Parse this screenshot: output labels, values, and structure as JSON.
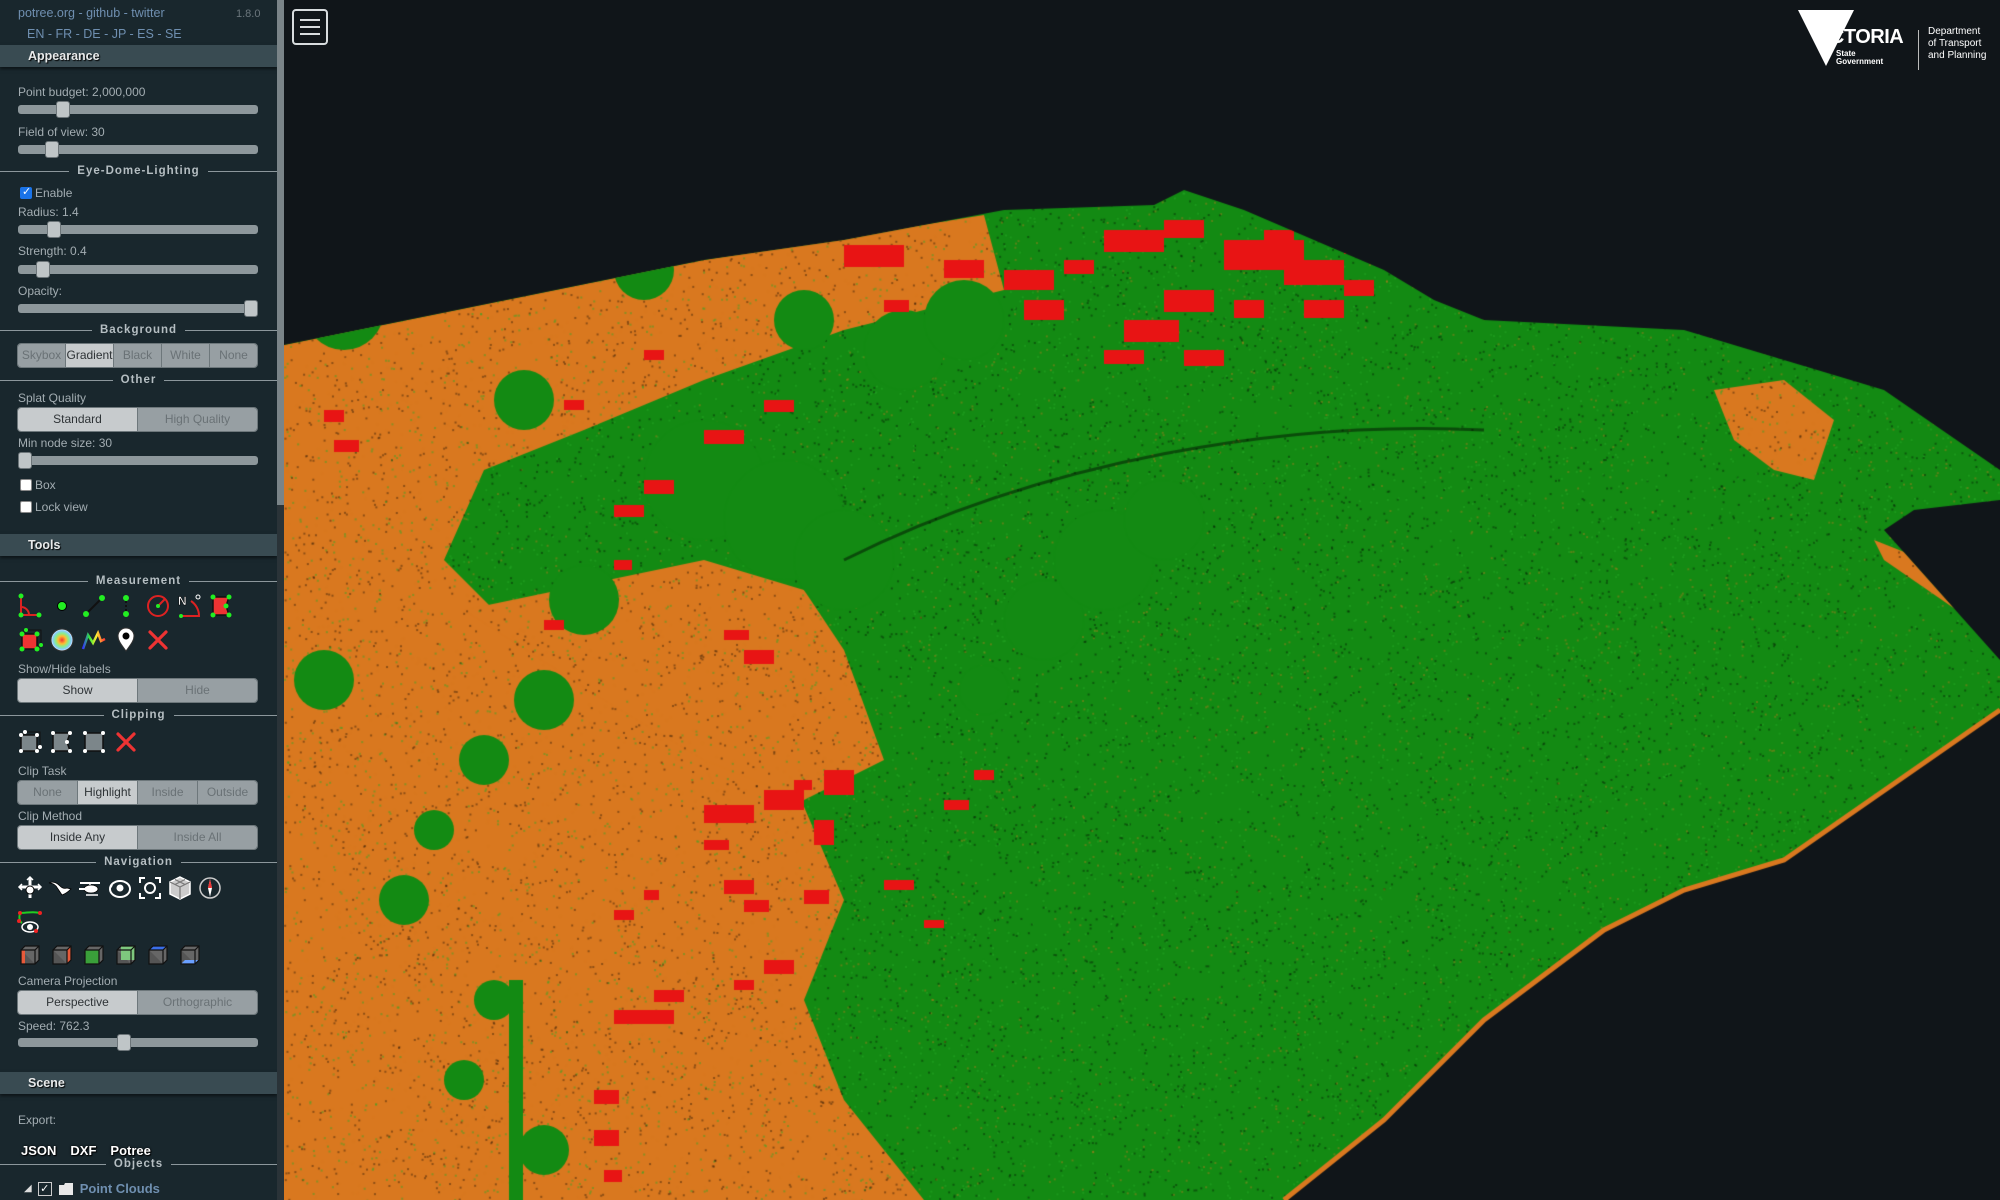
{
  "header": {
    "links": [
      "potree.org",
      "github",
      "twitter"
    ],
    "link_sep": " - ",
    "version": "1.8.0",
    "languages": "EN - FR - DE - JP - ES - SE"
  },
  "appearance": {
    "title": "Appearance",
    "point_budget_label": "Point budget: 2,000,000",
    "point_budget_value": 2000000,
    "point_budget_fraction": 0.17,
    "fov_label": "Field of view: 30",
    "fov_fraction": 0.12,
    "edl": {
      "title": "Eye-Dome-Lighting",
      "enable_label": "Enable",
      "enabled": true,
      "radius_label": "Radius: 1.4",
      "radius_fraction": 0.13,
      "strength_label": "Strength: 0.4",
      "strength_fraction": 0.08,
      "opacity_label": "Opacity:",
      "opacity_fraction": 1.0
    },
    "background": {
      "title": "Background",
      "options": [
        "Skybox",
        "Gradient",
        "Black",
        "White",
        "None"
      ],
      "selected": "Gradient"
    },
    "other": {
      "title": "Other",
      "splat_label": "Splat Quality",
      "splat_options": [
        "Standard",
        "High Quality"
      ],
      "splat_selected": "Standard",
      "min_node_label": "Min node size: 30",
      "min_node_fraction": 0.0,
      "box_label": "Box",
      "box_checked": false,
      "lock_view_label": "Lock view",
      "lock_view_checked": false
    }
  },
  "tools": {
    "title": "Tools",
    "measurement": {
      "title": "Measurement",
      "icons": [
        "angle-icon",
        "point-icon",
        "distance-icon",
        "height-icon",
        "circle-icon",
        "azimuth-icon",
        "area-icon",
        "volume-icon",
        "sphere-volume-icon",
        "profile-icon",
        "annotation-icon",
        "remove-measurements-icon"
      ],
      "labels_title": "Show/Hide labels",
      "labels_options": [
        "Show",
        "Hide"
      ],
      "labels_selected": "Show"
    },
    "clipping": {
      "title": "Clipping",
      "icons": [
        "clip-volume-icon",
        "clip-polygon-icon",
        "clip-screen-box-icon",
        "remove-clipping-icon"
      ],
      "task_label": "Clip Task",
      "task_options": [
        "None",
        "Highlight",
        "Inside",
        "Outside"
      ],
      "task_selected": "Highlight",
      "method_label": "Clip Method",
      "method_options": [
        "Inside Any",
        "Inside All"
      ],
      "method_selected": "Inside Any"
    },
    "navigation": {
      "title": "Navigation",
      "icons": [
        "earth-controls-icon",
        "fly-controls-icon",
        "helicopter-controls-icon",
        "orbit-controls-icon",
        "focus-icon",
        "full-extent-icon",
        "compass-icon",
        "camera-animation-icon"
      ],
      "view_icons": [
        "left-view-icon",
        "right-view-icon",
        "front-view-icon",
        "back-view-icon",
        "top-view-icon",
        "bottom-view-icon"
      ],
      "projection_label": "Camera Projection",
      "projection_options": [
        "Perspective",
        "Orthographic"
      ],
      "projection_selected": "Perspective",
      "speed_label": "Speed: 762.3",
      "speed_fraction": 0.44
    }
  },
  "scene": {
    "title": "Scene",
    "export_label": "Export:",
    "export_options": [
      "JSON",
      "DXF",
      "Potree"
    ],
    "objects_title": "Objects",
    "tree_root": "Point Clouds",
    "tree_root_checked": true
  },
  "viewer": {
    "menu_icon": "hamburger-menu-icon",
    "logo": {
      "name": "VICTORIA",
      "sub1": "State",
      "sub2": "Government",
      "dept1": "Department",
      "dept2": "of Transport",
      "dept3": "and Planning"
    },
    "colors": {
      "ground": "#d9781f",
      "vegetation": "#138a13",
      "building": "#e81414",
      "background": "#101519"
    }
  }
}
